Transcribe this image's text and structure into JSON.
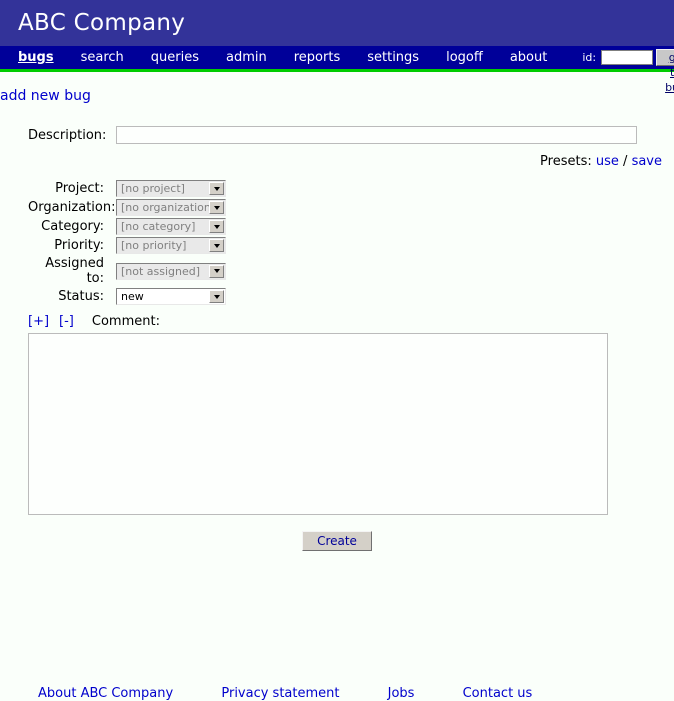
{
  "header": {
    "company_title": "ABC Company",
    "banner_color": "#333399"
  },
  "nav": {
    "bar_color": "#000099",
    "rule_color": "#00CC00",
    "items": [
      {
        "label": "bugs",
        "active": true
      },
      {
        "label": "search",
        "active": false
      },
      {
        "label": "queries",
        "active": false
      },
      {
        "label": "admin",
        "active": false
      },
      {
        "label": "reports",
        "active": false
      },
      {
        "label": "settings",
        "active": false
      },
      {
        "label": "logoff",
        "active": false
      },
      {
        "label": "about",
        "active": false
      }
    ],
    "goto": {
      "id_label": "id:",
      "id_value": "",
      "id_placeholder": "",
      "button_label": "go to bug"
    }
  },
  "page": {
    "breadcrumb_label": "add new bug",
    "background_color": "#FAFFFA",
    "link_color": "#0000CC"
  },
  "form": {
    "description": {
      "label": "Description:",
      "value": "",
      "placeholder": ""
    },
    "presets": {
      "label": "Presets:",
      "use_label": "use",
      "separator": "/",
      "save_label": "save"
    },
    "fields": [
      {
        "label": "Project:",
        "value": "[no project]",
        "enabled": false
      },
      {
        "label": "Organization:",
        "value": "[no organization]",
        "enabled": false
      },
      {
        "label": "Category:",
        "value": "[no category]",
        "enabled": false
      },
      {
        "label": "Priority:",
        "value": "[no priority]",
        "enabled": false
      },
      {
        "label": "Assigned to:",
        "value": "[not assigned]",
        "enabled": false
      },
      {
        "label": "Status:",
        "value": "new",
        "enabled": true
      }
    ],
    "comment": {
      "expand_label": "[+]",
      "collapse_label": "[-]",
      "label": "Comment:",
      "value": "",
      "placeholder": ""
    },
    "submit_label": "Create"
  },
  "footer": {
    "links": [
      {
        "label": "About ABC Company"
      },
      {
        "label": "Privacy statement"
      },
      {
        "label": "Jobs"
      },
      {
        "label": "Contact us"
      }
    ]
  }
}
